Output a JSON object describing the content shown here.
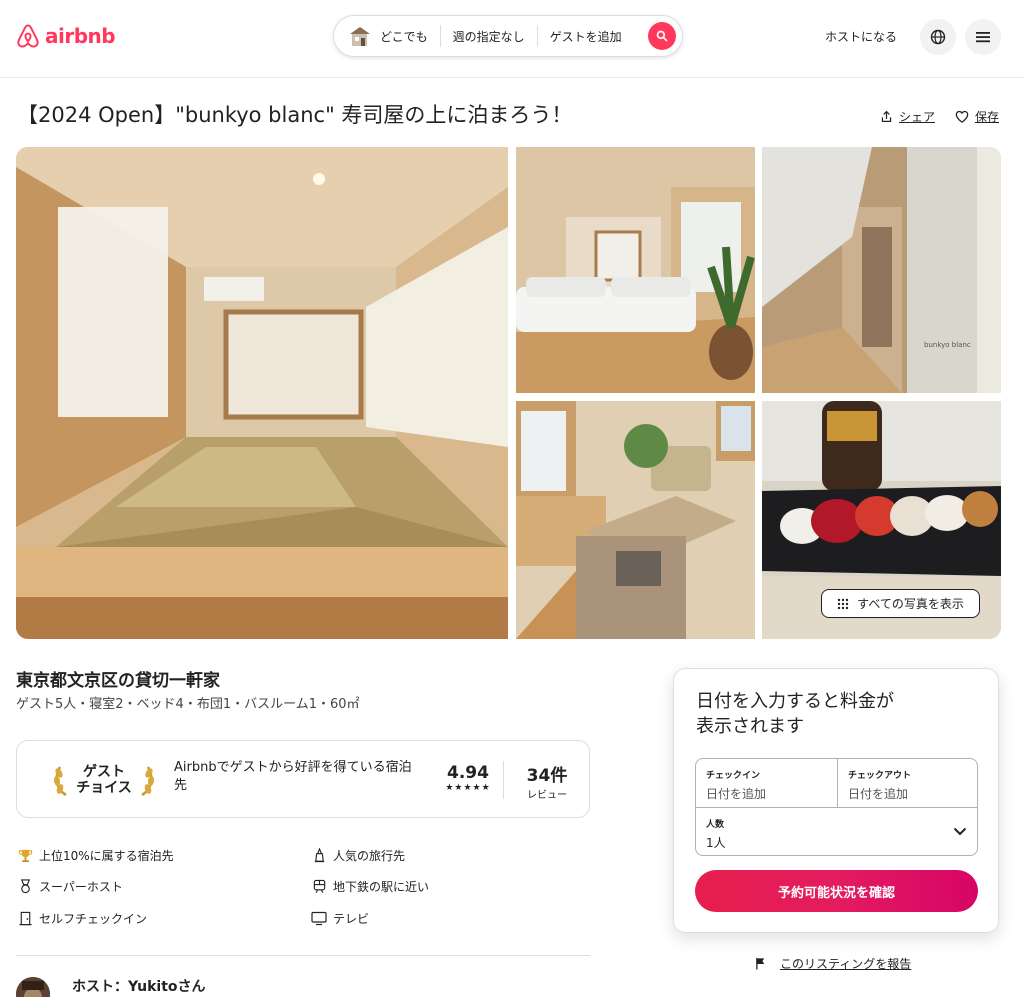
{
  "header": {
    "logo_text": "airbnb",
    "search": {
      "location": "どこでも",
      "dates": "週の指定なし",
      "guests": "ゲストを追加"
    },
    "host_link": "ホストになる"
  },
  "listing": {
    "title": "【2024 Open】\"bunkyo blanc\" 寿司屋の上に泊まろう！",
    "share_label": "シェア",
    "save_label": "保存",
    "show_all_photos": "すべての写真を表示",
    "subtitle": "東京都文京区の貸切一軒家",
    "details": "ゲスト5人・寝室2・ベッド4・布団1・バスルーム1・60㎡"
  },
  "guest_favorite": {
    "badge_line1": "ゲスト",
    "badge_line2": "チョイス",
    "description": "Airbnbでゲストから好評を得ている宿泊先",
    "rating": "4.94",
    "stars": "★★★★★",
    "reviews_count": "34件",
    "reviews_label": "レビュー"
  },
  "amenities": [
    {
      "icon": "trophy-icon",
      "label": "上位10%に属する宿泊先"
    },
    {
      "icon": "landmark-icon",
      "label": "人気の旅行先"
    },
    {
      "icon": "medal-icon",
      "label": "スーパーホスト"
    },
    {
      "icon": "train-icon",
      "label": "地下鉄の駅に近い"
    },
    {
      "icon": "door-icon",
      "label": "セルフチェックイン"
    },
    {
      "icon": "tv-icon",
      "label": "テレビ"
    }
  ],
  "host": {
    "name": "ホスト：Yukitoさん"
  },
  "booking": {
    "heading_line1": "日付を入力すると料金が",
    "heading_line2": "表示されます",
    "checkin_label": "チェックイン",
    "checkin_placeholder": "日付を追加",
    "checkout_label": "チェックアウト",
    "checkout_placeholder": "日付を追加",
    "guests_label": "人数",
    "guests_value": "1人",
    "button": "予約可能状況を確認"
  },
  "report_link": "このリスティングを報告",
  "colors": {
    "brand": "#ff385c",
    "text": "#222222",
    "border": "#dddddd"
  }
}
